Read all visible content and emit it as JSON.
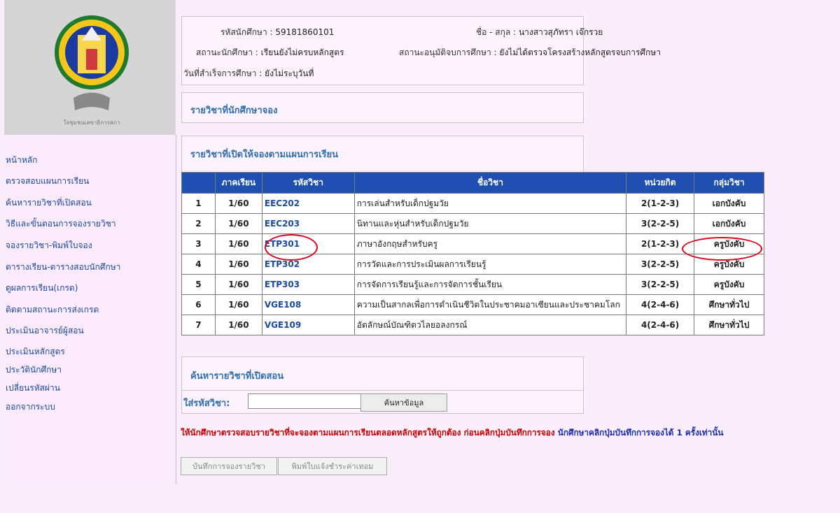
{
  "student": {
    "id_label": "รหัสนักศึกษา :",
    "id_value": "59181860101",
    "name_label": "ชื่อ - สกุล :",
    "name_value": "นางสาวสุภัทรา เจ๊กรวย",
    "status_label": "สถานะนักศึกษา :",
    "status_value": "เรียนยังไม่ครบหลักสูตร",
    "approval_label": "สถานะอนุมัติจบการศึกษา :",
    "approval_value": "ยังไม่ได้ตรวจโครงสร้างหลักสูตรจบการศึกษา",
    "grad_date_label": "วันที่สำเร็จการศึกษา :",
    "grad_date_value": "ยังไม่ระบุวันที่"
  },
  "sidebar": {
    "logo_text": "ใจชุมชนเลขาธิการสภา",
    "items": [
      {
        "label": "หน้าหลัก"
      },
      {
        "label": "ตรวจสอบแผนการเรียน"
      },
      {
        "label": "ค้นหารายวิชาที่เปิดสอน"
      },
      {
        "label": "วิธีและขั้นตอนการจองรายวิชา"
      },
      {
        "label": "จองรายวิชา-พิมพ์ใบจอง"
      },
      {
        "label": "ตารางเรียน-ตารางสอบนักศึกษา"
      },
      {
        "label": "ดูผลการเรียน(เกรด)"
      },
      {
        "label": "ติดตามสถานะการส่งเกรด"
      },
      {
        "label": "ประเมินอาจารย์ผู้สอน"
      },
      {
        "label": "ประเมินหลักสูตร"
      },
      {
        "label": "ประวัตินักศึกษา"
      },
      {
        "label": "เปลี่ยนรหัสผ่าน"
      },
      {
        "label": "ออกจากระบบ"
      }
    ]
  },
  "reserved_section": {
    "title": "รายวิชาที่นักศึกษาจอง"
  },
  "plan_section": {
    "title": "รายวิชาที่เปิดให้จองตามแผนการเรียน",
    "columns": [
      "",
      "ภาคเรียน",
      "รหัสวิชา",
      "ชื่อวิชา",
      "หน่วยกิต",
      "กลุ่มวิชา"
    ],
    "rows": [
      {
        "no": "1",
        "term": "1/60",
        "code": "EEC202",
        "name": "การเล่นสำหรับเด็กปฐมวัย",
        "credit": "2(1-2-3)",
        "group": "เอกบังคับ"
      },
      {
        "no": "2",
        "term": "1/60",
        "code": "EEC203",
        "name": "นิทานและหุ่นสำหรับเด็กปฐมวัย",
        "credit": "3(2-2-5)",
        "group": "เอกบังคับ"
      },
      {
        "no": "3",
        "term": "1/60",
        "code": "ETP301",
        "name": "ภาษาอังกฤษสำหรับครู",
        "credit": "2(1-2-3)",
        "group": "ครูบังคับ"
      },
      {
        "no": "4",
        "term": "1/60",
        "code": "ETP302",
        "name": "การวัดและการประเมินผลการเรียนรู้",
        "credit": "3(2-2-5)",
        "group": "ครูบังคับ"
      },
      {
        "no": "5",
        "term": "1/60",
        "code": "ETP303",
        "name": "การจัดการเรียนรู้และการจัดการชั้นเรียน",
        "credit": "3(2-2-5)",
        "group": "ครูบังคับ"
      },
      {
        "no": "6",
        "term": "1/60",
        "code": "VGE108",
        "name": "ความเป็นสากลเพื่อการดำเนินชีวิตในประชาคมอาเซียนและประชาคมโลก",
        "credit": "4(2-4-6)",
        "group": "ศึกษาทั่วไป"
      },
      {
        "no": "7",
        "term": "1/60",
        "code": "VGE109",
        "name": "อัตลักษณ์บัณฑิตวไลยอลงกรณ์",
        "credit": "4(2-4-6)",
        "group": "ศึกษาทั่วไป"
      }
    ]
  },
  "search": {
    "title": "ค้นหารายวิชาที่เปิดสอน",
    "label": "ใส่รหัสวิชา:",
    "value": "",
    "button": "ค้นหาข้อมูล"
  },
  "notice": {
    "red": "ให้นักศึกษาตรวจสอบรายวิชาที่จะจองตามแผนการเรียนตลอดหลักสูตรให้ถูกต้อง ก่อนคลิกปุ่มบันทึกการจอง",
    "blue": "นักศึกษาคลิกปุ่มบันทึกการจองได้ 1 ครั้งเท่านั้น"
  },
  "actions": {
    "save": "บันทึกการจองรายวิชา",
    "print": "พิมพ์ใบแจ้งชำระค่าเทอม"
  },
  "colors": {
    "header_bg": "#1f4fb1",
    "link": "#1a4aa0",
    "section_title": "#2f6fb1",
    "highlight_circle": "#e0001b"
  }
}
